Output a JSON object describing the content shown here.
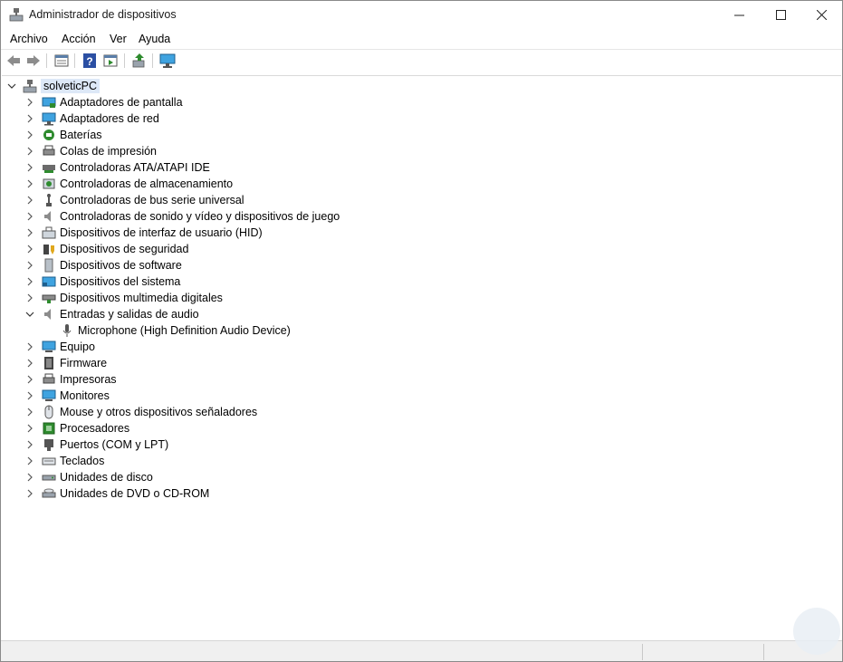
{
  "window": {
    "title": "Administrador de dispositivos",
    "controls": [
      "minimize",
      "maximize",
      "close"
    ]
  },
  "menu": [
    "Archivo",
    "Acción",
    "Ver",
    "Ayuda"
  ],
  "toolbar": {
    "buttons": [
      "back-icon",
      "forward-icon",
      "properties-icon",
      "help-icon",
      "run-icon",
      "update-driver-icon",
      "scan-hardware-icon"
    ]
  },
  "tree": {
    "root": "solveticPC",
    "categories": [
      {
        "label": "Adaptadores de pantalla",
        "icon": "display-adapter-icon",
        "expanded": false
      },
      {
        "label": "Adaptadores de red",
        "icon": "network-adapter-icon",
        "expanded": false
      },
      {
        "label": "Baterías",
        "icon": "battery-icon",
        "expanded": false
      },
      {
        "label": "Colas de impresión",
        "icon": "print-queue-icon",
        "expanded": false
      },
      {
        "label": "Controladoras ATA/ATAPI IDE",
        "icon": "ide-controller-icon",
        "expanded": false
      },
      {
        "label": "Controladoras de almacenamiento",
        "icon": "storage-controller-icon",
        "expanded": false
      },
      {
        "label": "Controladoras de bus serie universal",
        "icon": "usb-icon",
        "expanded": false
      },
      {
        "label": "Controladoras de sonido y vídeo y dispositivos de juego",
        "icon": "speaker-icon",
        "expanded": false
      },
      {
        "label": "Dispositivos de interfaz de usuario (HID)",
        "icon": "hid-icon",
        "expanded": false
      },
      {
        "label": "Dispositivos de seguridad",
        "icon": "security-icon",
        "expanded": false
      },
      {
        "label": "Dispositivos de software",
        "icon": "software-device-icon",
        "expanded": false
      },
      {
        "label": "Dispositivos del sistema",
        "icon": "system-device-icon",
        "expanded": false
      },
      {
        "label": "Dispositivos multimedia digitales",
        "icon": "multimedia-icon",
        "expanded": false
      },
      {
        "label": "Entradas y salidas de audio",
        "icon": "audio-io-icon",
        "expanded": true,
        "children": [
          {
            "label": "Microphone (High Definition Audio Device)",
            "icon": "microphone-icon"
          }
        ]
      },
      {
        "label": "Equipo",
        "icon": "computer-icon",
        "expanded": false
      },
      {
        "label": "Firmware",
        "icon": "firmware-icon",
        "expanded": false
      },
      {
        "label": "Impresoras",
        "icon": "printer-icon",
        "expanded": false
      },
      {
        "label": "Monitores",
        "icon": "monitor-icon",
        "expanded": false
      },
      {
        "label": "Mouse y otros dispositivos señaladores",
        "icon": "mouse-icon",
        "expanded": false
      },
      {
        "label": "Procesadores",
        "icon": "processor-icon",
        "expanded": false
      },
      {
        "label": "Puertos (COM y LPT)",
        "icon": "port-icon",
        "expanded": false
      },
      {
        "label": "Teclados",
        "icon": "keyboard-icon",
        "expanded": false
      },
      {
        "label": "Unidades de disco",
        "icon": "disk-drive-icon",
        "expanded": false
      },
      {
        "label": "Unidades de DVD o CD-ROM",
        "icon": "dvd-drive-icon",
        "expanded": false
      }
    ]
  },
  "colors": {
    "selection": "#dde8f7",
    "accent": "#0078d4"
  }
}
